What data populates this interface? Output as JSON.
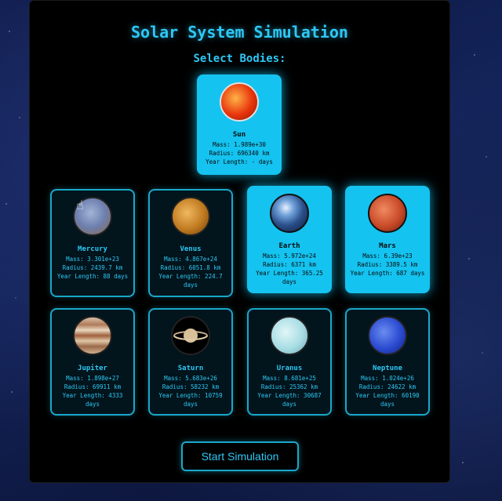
{
  "title": "Solar System Simulation",
  "subtitle": "Select Bodies:",
  "bodies": [
    {
      "name": "Sun",
      "mass": "Mass: 1.989e+30",
      "radius": "Radius: 696340 km",
      "year": "Year Length: - days",
      "selected": true
    },
    {
      "name": "Mercury",
      "mass": "Mass: 3.301e+23",
      "radius": "Radius: 2439.7 km",
      "year": "Year Length: 88 days",
      "selected": false
    },
    {
      "name": "Venus",
      "mass": "Mass: 4.867e+24",
      "radius": "Radius: 6051.8 km",
      "year": "Year Length: 224.7 days",
      "selected": false
    },
    {
      "name": "Earth",
      "mass": "Mass: 5.972e+24",
      "radius": "Radius: 6371 km",
      "year": "Year Length: 365.25 days",
      "selected": true
    },
    {
      "name": "Mars",
      "mass": "Mass: 6.39e+23",
      "radius": "Radius: 3389.5 km",
      "year": "Year Length: 687 days",
      "selected": true
    },
    {
      "name": "Jupiter",
      "mass": "Mass: 1.898e+27",
      "radius": "Radius: 69911 km",
      "year": "Year Length: 4333 days",
      "selected": false
    },
    {
      "name": "Saturn",
      "mass": "Mass: 5.683e+26",
      "radius": "Radius: 58232 km",
      "year": "Year Length: 10759 days",
      "selected": false
    },
    {
      "name": "Uranus",
      "mass": "Mass: 8.681e+25",
      "radius": "Radius: 25362 km",
      "year": "Year Length: 30687 days",
      "selected": false
    },
    {
      "name": "Neptune",
      "mass": "Mass: 1.024e+26",
      "radius": "Radius: 24622 km",
      "year": "Year Length: 60190 days",
      "selected": false
    }
  ],
  "start_button": "Start Simulation"
}
